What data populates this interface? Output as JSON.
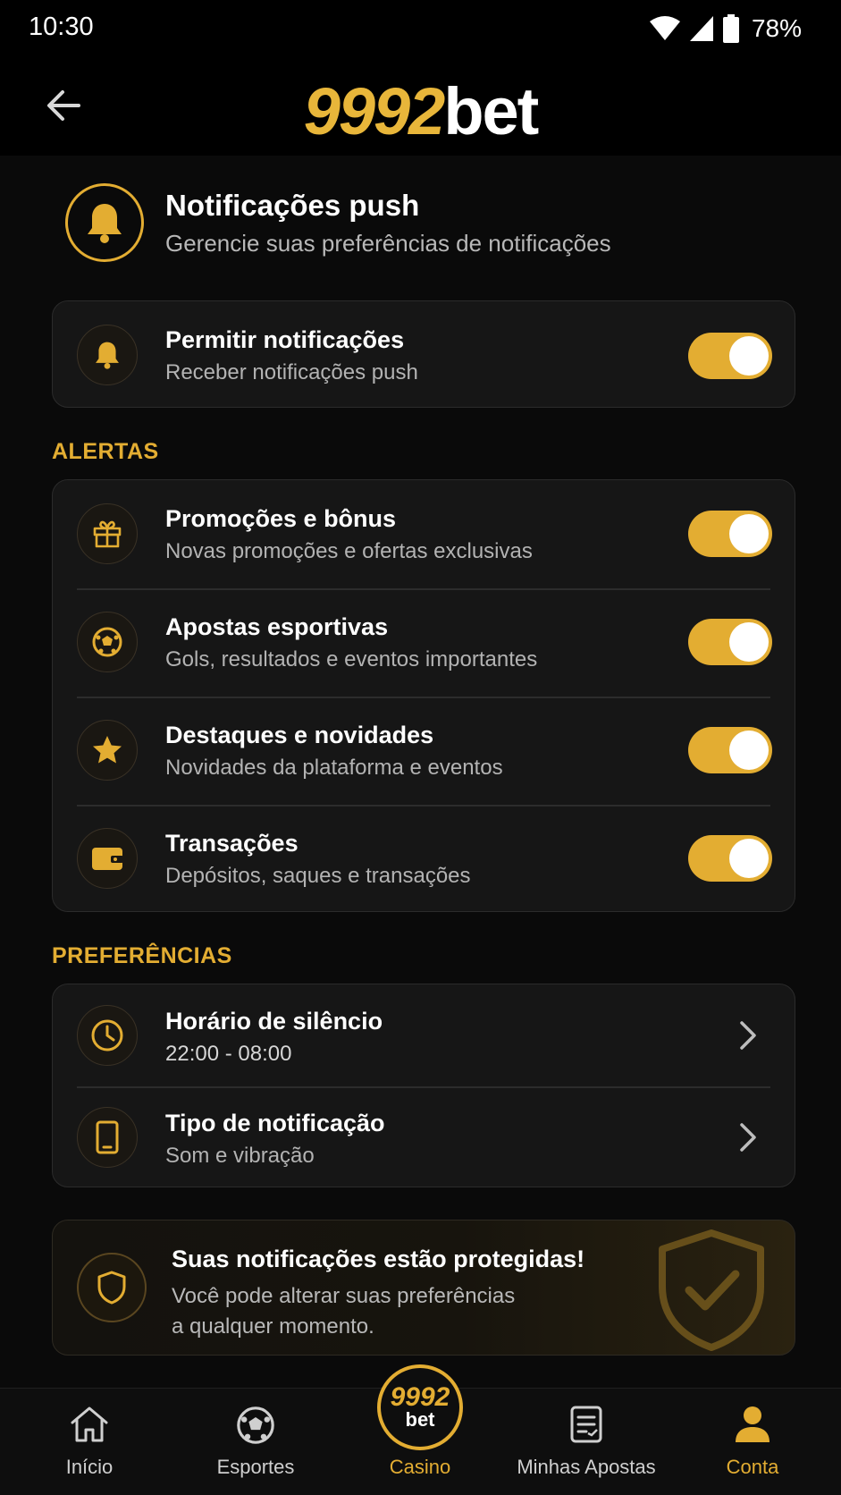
{
  "status_bar": {
    "time": "10:30",
    "battery": "78%"
  },
  "header": {
    "logo_number": "9992",
    "logo_word": "bet"
  },
  "page": {
    "title": "Notificações push",
    "subtitle": "Gerencie suas preferências de notificações"
  },
  "master": {
    "title": "Permitir notificações",
    "subtitle": "Receber notificações push",
    "enabled": true,
    "icon": "bell-icon"
  },
  "alerts": {
    "label": "ALERTAS",
    "items": [
      {
        "title": "Promoções e bônus",
        "subtitle": "Novas promoções e ofertas exclusivas",
        "enabled": true,
        "icon": "gift-icon"
      },
      {
        "title": "Apostas esportivas",
        "subtitle": "Gols, resultados e eventos importantes",
        "enabled": true,
        "icon": "soccer-ball-icon"
      },
      {
        "title": "Destaques e novidades",
        "subtitle": "Novidades da plataforma e eventos",
        "enabled": true,
        "icon": "star-icon"
      },
      {
        "title": "Transações",
        "subtitle": "Depósitos, saques e transações",
        "enabled": true,
        "icon": "wallet-icon"
      }
    ]
  },
  "preferences": {
    "label": "PREFERÊNCIAS",
    "items": [
      {
        "title": "Horário de silêncio",
        "value": "22:00 - 08:00",
        "icon": "clock-icon"
      },
      {
        "title": "Tipo de notificação",
        "value": "Som e vibração",
        "icon": "phone-icon"
      }
    ]
  },
  "banner": {
    "title": "Suas notificações estão protegidas!",
    "line1": "Você pode alterar suas preferências",
    "line2": "a qualquer momento."
  },
  "bottom_nav": {
    "items": [
      {
        "label": "Início",
        "icon": "home-icon"
      },
      {
        "label": "Esportes",
        "icon": "soccer-ball-icon"
      },
      {
        "label": "Casino",
        "icon": "casino-logo"
      },
      {
        "label": "Minhas Apostas",
        "icon": "receipt-icon"
      },
      {
        "label": "Conta",
        "icon": "user-icon"
      }
    ],
    "casino_logo_number": "9992",
    "casino_logo_word": "bet",
    "active_index": 4
  },
  "colors": {
    "accent": "#e3ad32",
    "background": "#0a0a0a",
    "card": "#161616"
  }
}
